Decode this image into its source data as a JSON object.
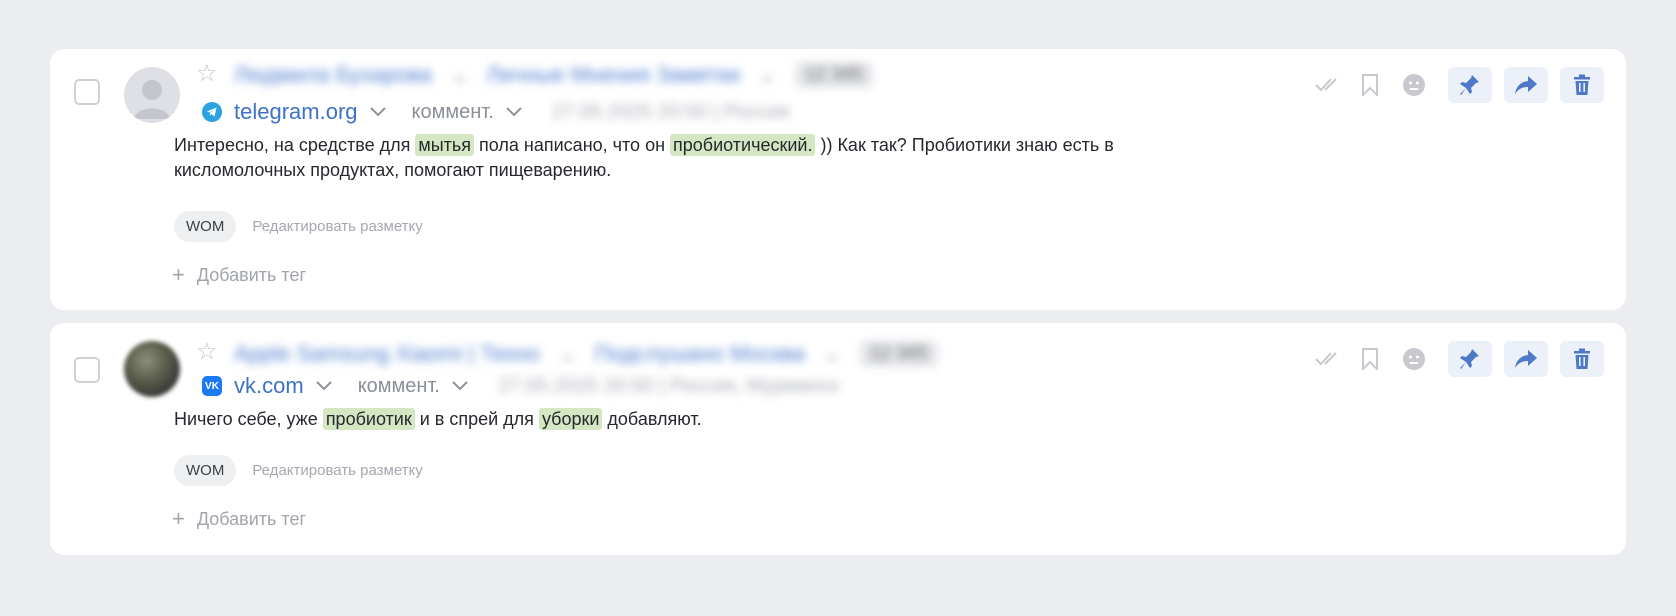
{
  "posts": [
    {
      "author_blurred": "Людмила Бухарова",
      "group_blurred": "Личные Мнения Заметки",
      "count_blurred": "12 345",
      "source_name": "telegram.org",
      "source_icon": "telegram-icon",
      "type_label": "коммент.",
      "meta_blurred": "27.05.2025 20:50 | Россия",
      "text_parts": [
        {
          "t": "Интересно, на средстве для ",
          "h": false
        },
        {
          "t": "мытья",
          "h": true
        },
        {
          "t": " пола написано, что он ",
          "h": false
        },
        {
          "t": "пробиотический.",
          "h": true
        },
        {
          "t": " )) Как так? Пробиотики знаю есть в кисломолочных продуктах, помогают пищеварению.",
          "h": false
        }
      ],
      "tag": "WOM",
      "edit_label": "Редактировать разметку",
      "add_tag_label": "Добавить тег"
    },
    {
      "author_blurred": "Apple Samsung Xiaomi | Техно",
      "group_blurred": "Подслушано Москва",
      "count_blurred": "12 345",
      "source_name": "vk.com",
      "source_icon": "vk-icon",
      "type_label": "коммент.",
      "meta_blurred": "27.05.2025 20:50 | Россия, Мурманск",
      "text_parts": [
        {
          "t": "Ничего себе, уже ",
          "h": false
        },
        {
          "t": "пробиотик",
          "h": true
        },
        {
          "t": " и в спрей для ",
          "h": false
        },
        {
          "t": "уборки",
          "h": true
        },
        {
          "t": " добавляют.",
          "h": false
        }
      ],
      "tag": "WOM",
      "edit_label": "Редактировать разметку",
      "add_tag_label": "Добавить тег"
    }
  ],
  "icons": {
    "star": "☆",
    "chevron": "chevron-down-icon",
    "plus": "+"
  },
  "colors": {
    "highlight": "#d4e7c2",
    "link": "#3d72c7",
    "action_accent": "#4f78c9"
  }
}
